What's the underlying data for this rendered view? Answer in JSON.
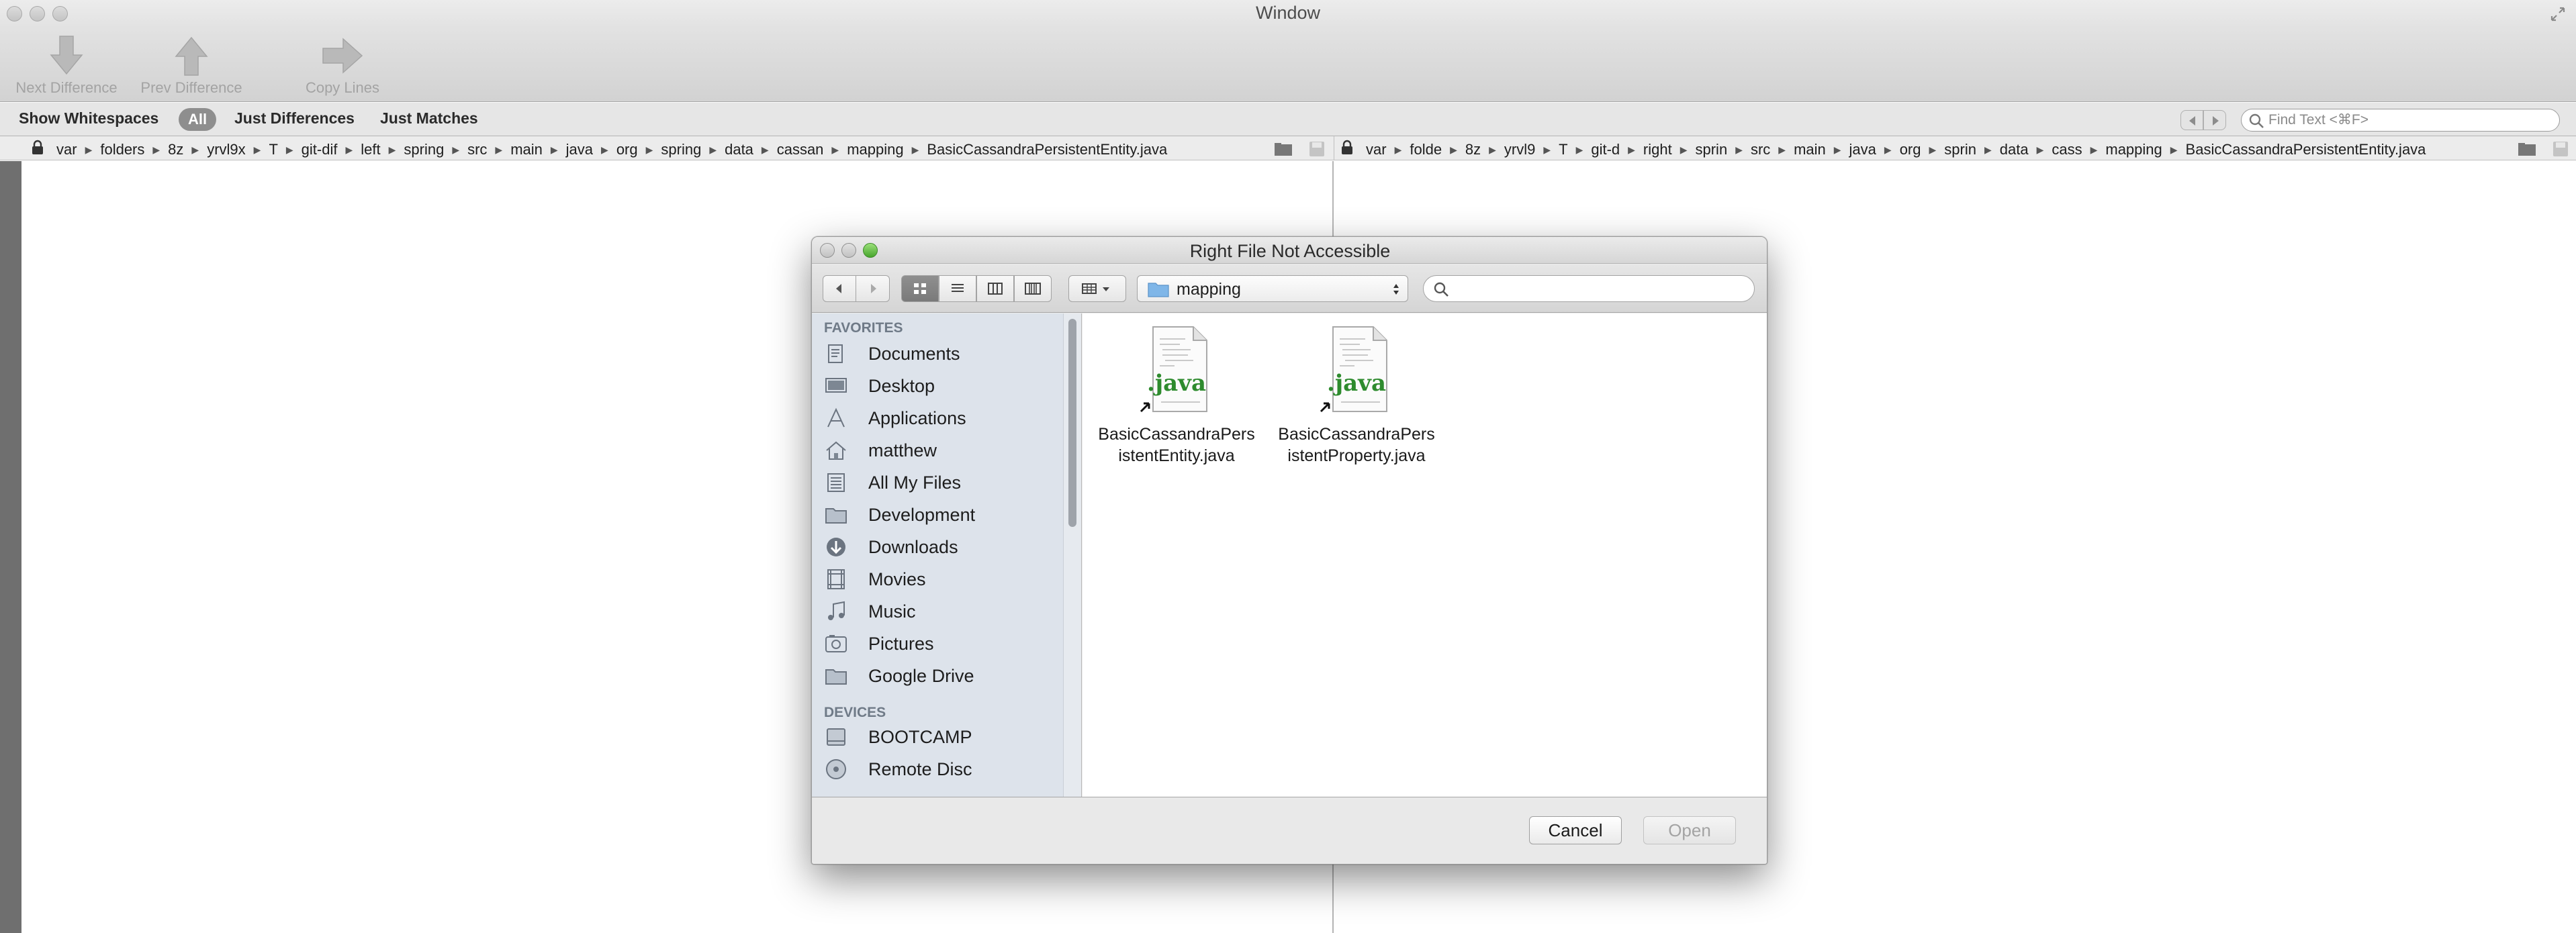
{
  "window": {
    "title": "Window"
  },
  "toolbar": {
    "next_label": "Next Difference",
    "prev_label": "Prev Difference",
    "copy_label": "Copy Lines"
  },
  "filterbar": {
    "show_whitespaces": "Show Whitespaces",
    "all": "All",
    "just_differences": "Just Differences",
    "just_matches": "Just Matches",
    "find_placeholder": "Find Text <⌘F>"
  },
  "paths": {
    "left": [
      "var",
      "folders",
      "8z",
      "yrvl9x",
      "T",
      "git-dif",
      "left",
      "spring",
      "src",
      "main",
      "java",
      "org",
      "spring",
      "data",
      "cassan",
      "mapping",
      "BasicCassandraPersistentEntity.java"
    ],
    "right": [
      "var",
      "folde",
      "8z",
      "yrvl9",
      "T",
      "git-d",
      "right",
      "sprin",
      "src",
      "main",
      "java",
      "org",
      "sprin",
      "data",
      "cass",
      "mapping",
      "BasicCassandraPersistentEntity.java"
    ]
  },
  "dialog": {
    "title": "Right File Not Accessible",
    "location": "mapping",
    "search_value": "",
    "sidebar": {
      "favorites_heading": "FAVORITES",
      "favorites": [
        {
          "label": "Documents",
          "icon": "documents-icon"
        },
        {
          "label": "Desktop",
          "icon": "desktop-icon"
        },
        {
          "label": "Applications",
          "icon": "applications-icon"
        },
        {
          "label": "matthew",
          "icon": "home-icon"
        },
        {
          "label": "All My Files",
          "icon": "all-my-files-icon"
        },
        {
          "label": "Development",
          "icon": "folder-icon"
        },
        {
          "label": "Downloads",
          "icon": "downloads-icon"
        },
        {
          "label": "Movies",
          "icon": "movies-icon"
        },
        {
          "label": "Music",
          "icon": "music-icon"
        },
        {
          "label": "Pictures",
          "icon": "pictures-icon"
        },
        {
          "label": "Google Drive",
          "icon": "folder-icon"
        }
      ],
      "devices_heading": "DEVICES",
      "devices": [
        {
          "label": "BOOTCAMP",
          "icon": "drive-icon"
        },
        {
          "label": "Remote Disc",
          "icon": "disc-icon"
        }
      ]
    },
    "files": [
      {
        "line1": "BasicCassandraPers",
        "line2": "istentEntity.java",
        "badge": ".java"
      },
      {
        "line1": "BasicCassandraPers",
        "line2": "istentProperty.java",
        "badge": ".java"
      }
    ],
    "cancel_label": "Cancel",
    "open_label": "Open"
  },
  "colors": {
    "gutter": "#6f6f6f",
    "sidebar": "#dde3eb",
    "java_green": "#2e8b2e"
  }
}
